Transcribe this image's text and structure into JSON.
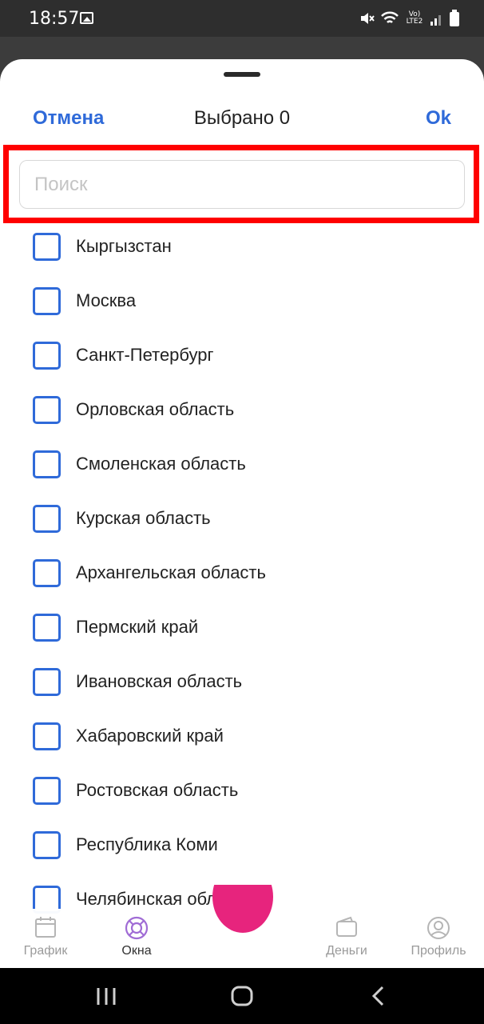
{
  "status_bar": {
    "time": "18:57",
    "network_label": "Vo) LTE2"
  },
  "sheet": {
    "cancel_label": "Отмена",
    "title": "Выбрано 0",
    "ok_label": "Ok",
    "search": {
      "placeholder": "Поиск",
      "value": ""
    }
  },
  "items": [
    {
      "label": "Кыргызстан",
      "checked": false
    },
    {
      "label": "Москва",
      "checked": false
    },
    {
      "label": "Санкт-Петербург",
      "checked": false
    },
    {
      "label": "Орловская область",
      "checked": false
    },
    {
      "label": "Смоленская область",
      "checked": false
    },
    {
      "label": "Курская область",
      "checked": false
    },
    {
      "label": "Архангельская область",
      "checked": false
    },
    {
      "label": "Пермский край",
      "checked": false
    },
    {
      "label": "Ивановская область",
      "checked": false
    },
    {
      "label": "Хабаровский край",
      "checked": false
    },
    {
      "label": "Ростовская область",
      "checked": false
    },
    {
      "label": "Республика Коми",
      "checked": false
    },
    {
      "label": "Челябинская область",
      "checked": false
    }
  ],
  "tabbar": {
    "tabs": [
      {
        "label": "График",
        "icon": "calendar-icon",
        "active": false
      },
      {
        "label": "Окна",
        "icon": "lifebuoy-icon",
        "active": true
      },
      {
        "label": "Деньги",
        "icon": "wallet-icon",
        "active": false
      },
      {
        "label": "Профиль",
        "icon": "profile-icon",
        "active": false
      }
    ]
  },
  "colors": {
    "accent": "#2f6ad9",
    "active_tab": "#a06cd5",
    "fab": "#e7247d",
    "highlight": "#ff0000"
  }
}
